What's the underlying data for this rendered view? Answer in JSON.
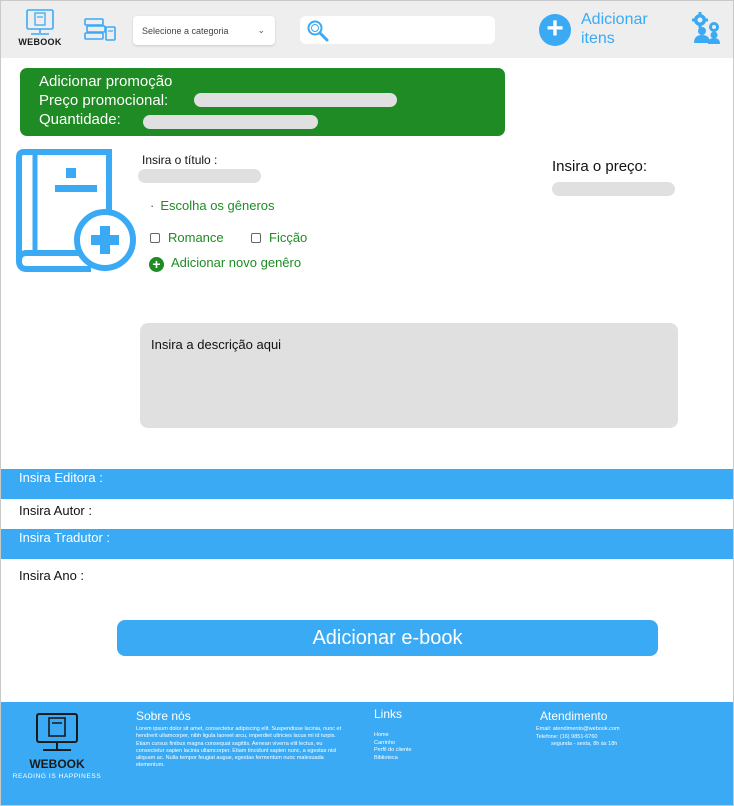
{
  "header": {
    "logo_text": "WEBOOK",
    "category_placeholder": "Selecione a categoria",
    "add_items_label": "Adicionar itens"
  },
  "promo": {
    "title": "Adicionar promoção",
    "price_label": "Preço promocional:",
    "quantity_label": "Quantidade:",
    "bg_color": "#1f8b24"
  },
  "form": {
    "title_label": "Insira o título :",
    "price_label": "Insira o preço:",
    "genres_label": "Escolha os gêneros",
    "genres": [
      "Romance",
      "Ficção"
    ],
    "add_genre_label": "Adicionar novo genêro",
    "description_placeholder": "Insira a descrição aqui",
    "publisher_label": "Insira Editora :",
    "author_label": "Insira Autor :",
    "translator_label": "Insira Tradutor :",
    "year_label": "Insira Ano :",
    "submit_label": "Adicionar e-book"
  },
  "footer": {
    "logo_text": "WEBOOK",
    "tagline": "READING IS HAPPINESS",
    "about_title": "Sobre nós",
    "about_text": "Lorem ipsum dolor sit amet, consectetur adipiscing elit. Suspendisse lacinia, nunc et hendrerit ullamcorper, nibh ligula laoreet arcu, imperdiet ultricies lacus mi id turpis. Etiam cursus finibus magna consequat sagittis. Aenean viverra elit lectus, eu consectetur sapien lacinia ullamcorper. Etiam tincidunt sapien nunc, a egestas nisl aliquam ac. Nulla tempor feugiat augue, egestas fermentum nunc malesuada elementum.",
    "links_title": "Links",
    "links": [
      "Home",
      "Carrinho",
      "Perfil do cliente",
      "Biblioteca"
    ],
    "service_title": "Atendimento",
    "email": "Email: atendimento@webook.com",
    "phone": "Telefone: (16) 9851-6760",
    "hours": "segunda - sexta, 8h às 18h"
  },
  "colors": {
    "accent": "#3aaaf5",
    "green": "#1f8b24",
    "input_gray": "#e0e0e0",
    "header_bg": "#eeeeee"
  },
  "icons": [
    "computer-book-icon",
    "books-stack-icon",
    "chevron-down-icon",
    "search-icon",
    "plus-circle-icon",
    "users-gear-icon",
    "book-add-icon",
    "plus-icon"
  ]
}
